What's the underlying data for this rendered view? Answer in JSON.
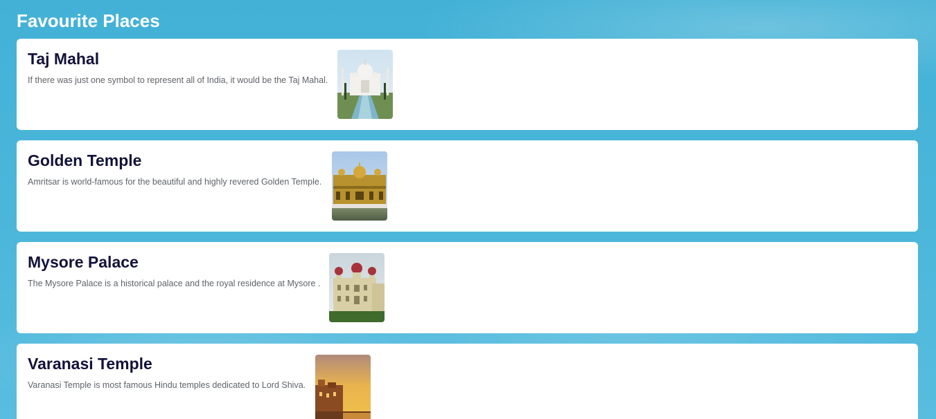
{
  "page": {
    "title": "Favourite Places"
  },
  "places": [
    {
      "title": "Taj Mahal",
      "description": "If there was just one symbol to represent all of India, it would be the Taj Mahal."
    },
    {
      "title": "Golden Temple",
      "description": "Amritsar is world-famous for the beautiful and highly revered Golden Temple."
    },
    {
      "title": "Mysore Palace",
      "description": "The Mysore Palace is a historical palace and the royal residence at Mysore ."
    },
    {
      "title": "Varanasi Temple",
      "description": "Varanasi Temple is most famous Hindu temples dedicated to Lord Shiva."
    }
  ],
  "colors": {
    "background": "#45b3d8",
    "card": "#ffffff",
    "title_text": "#12123a",
    "desc_text": "#5f6368"
  }
}
